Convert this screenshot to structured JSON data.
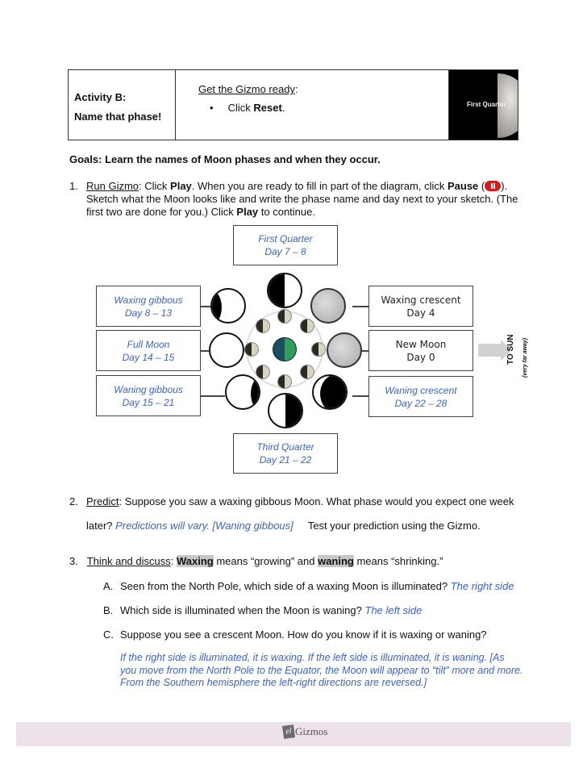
{
  "header": {
    "activity_label": "Activity B:",
    "activity_title": "Name that phase!",
    "setup_heading": "Get the Gizmo ready",
    "setup_colon": ":",
    "setup_bullet": "•",
    "setup_step_prefix": "Click ",
    "setup_step_bold": "Reset",
    "setup_step_suffix": ".",
    "image_label": "First Quarter"
  },
  "goals": "Goals: Learn the names of Moon phases and when they occur.",
  "q1": {
    "number": "1.",
    "label": "Run Gizmo",
    "t1": ": Click ",
    "b1": "Play",
    "t2": ". When you are ready to fill in part of the diagram, click ",
    "b2": "Pause",
    "t3": " (",
    "t4": ").",
    "t5": "Sketch what the Moon looks like and write the phase name and day next to your sketch. (The first two are done for you.) Click ",
    "b3": "Play",
    "t6": " to continue."
  },
  "diagram": {
    "first_quarter": {
      "name": "First Quarter",
      "day": "Day 7 – 8"
    },
    "waxing_gibbous": {
      "name": "Waxing gibbous",
      "day": "Day 8 – 13"
    },
    "full_moon": {
      "name": "Full Moon",
      "day": "Day 14 – 15"
    },
    "waning_gibbous": {
      "name": "Waning gibbous",
      "day": "Day 15 – 21"
    },
    "third_quarter": {
      "name": "Third Quarter",
      "day": "Day 21 – 22"
    },
    "waxing_crescent": {
      "name": "Waxing crescent",
      "day": "Day 4"
    },
    "new_moon": {
      "name": "New Moon",
      "day": "Day 0"
    },
    "waning_crescent": {
      "name": "Waning crescent",
      "day": "Day 22 – 28"
    },
    "to_sun": "TO SUN",
    "to_sun_note": "(very far away)"
  },
  "q2": {
    "number": "2.",
    "label": "Predict",
    "t1": ": Suppose you saw a waxing gibbous Moon. What phase would you expect one week",
    "t2": "later? ",
    "answer": "Predictions will vary. [Waning gibbous]",
    "t3": "Test your prediction using the Gizmo."
  },
  "q3": {
    "number": "3.",
    "label": "Think and discuss",
    "t1": ": ",
    "b1": "Waxing",
    "t2": " means “growing” and ",
    "b2": "waning",
    "t3": " means “shrinking.”",
    "A": {
      "letter": "A.",
      "question": "Seen from the North Pole, which side of a waxing Moon is illuminated? ",
      "answer": "The right side"
    },
    "B": {
      "letter": "B.",
      "question": "Which side is illuminated when the Moon is waning? ",
      "answer": "The left side"
    },
    "C": {
      "letter": "C.",
      "question": "Suppose you see a crescent Moon. How do you know if it is waxing or waning?",
      "answer": "If the right side is illuminated, it is waxing. If the left side is illuminated, it is waning. [As you move from the North Pole to the Equator, the Moon will appear to “tilt” more and more. From the Southern hemisphere the left-right directions are reversed.]"
    }
  },
  "footer": {
    "logo_mark": "el",
    "brand": "Gizmos"
  }
}
